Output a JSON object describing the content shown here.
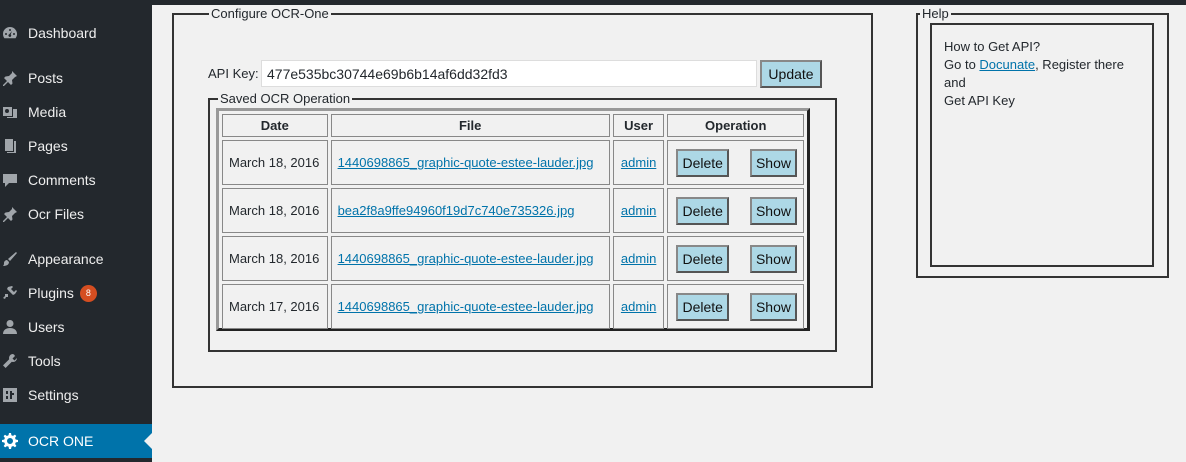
{
  "sidebar": {
    "items": [
      {
        "label": "Dashboard",
        "icon": "dashboard-icon"
      },
      {
        "label": "Posts",
        "icon": "pin-icon"
      },
      {
        "label": "Media",
        "icon": "media-icon"
      },
      {
        "label": "Pages",
        "icon": "pages-icon"
      },
      {
        "label": "Comments",
        "icon": "comment-icon"
      },
      {
        "label": "Ocr Files",
        "icon": "pin-icon"
      },
      {
        "label": "Appearance",
        "icon": "brush-icon"
      },
      {
        "label": "Plugins",
        "icon": "plugin-icon",
        "badge": "8"
      },
      {
        "label": "Users",
        "icon": "user-icon"
      },
      {
        "label": "Tools",
        "icon": "wrench-icon"
      },
      {
        "label": "Settings",
        "icon": "settings-icon"
      },
      {
        "label": "OCR ONE",
        "icon": "gear-icon",
        "active": true
      }
    ]
  },
  "config": {
    "legend": "Configure OCR-One",
    "api_label": "API Key:",
    "api_value": "477e535bc30744e69b6b14af6dd32fd3",
    "update_label": "Update"
  },
  "saved": {
    "legend": "Saved OCR Operation",
    "headers": [
      "Date",
      "File",
      "User",
      "Operation"
    ],
    "rows": [
      {
        "date": "March 18, 2016",
        "file": "1440698865_graphic-quote-estee-lauder.jpg",
        "user": "admin",
        "delete": "Delete",
        "show": "Show"
      },
      {
        "date": "March 18, 2016",
        "file": "bea2f8a9ffe94960f19d7c740e735326.jpg",
        "user": "admin",
        "delete": "Delete",
        "show": "Show"
      },
      {
        "date": "March 18, 2016",
        "file": "1440698865_graphic-quote-estee-lauder.jpg",
        "user": "admin",
        "delete": "Delete",
        "show": "Show"
      },
      {
        "date": "March 17, 2016",
        "file": "1440698865_graphic-quote-estee-lauder.jpg",
        "user": "admin",
        "delete": "Delete",
        "show": "Show"
      }
    ]
  },
  "help": {
    "legend": "Help",
    "line1": "How to Get API?",
    "line2_prefix": "Go to ",
    "link": "Docunate",
    "line2_suffix": ", Register there and",
    "line3": "Get API Key"
  },
  "colors": {
    "sidebar_bg": "#23282d",
    "active_bg": "#0073aa",
    "button_bg": "#add8e6",
    "badge_bg": "#d54e21"
  }
}
